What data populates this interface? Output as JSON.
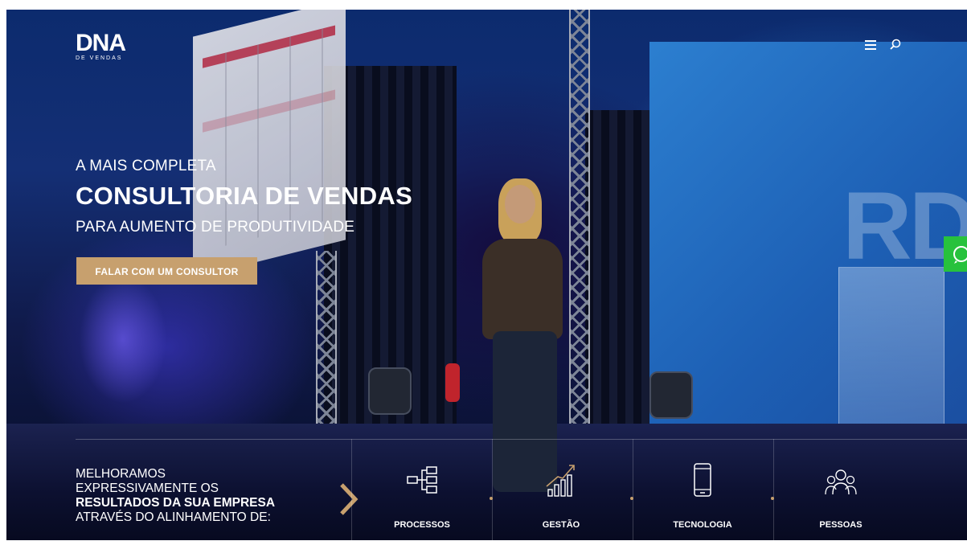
{
  "colors": {
    "accent": "#c7a06e",
    "whatsapp": "#27c23d",
    "text": "#ffffff"
  },
  "header": {
    "logo_main": "DNA",
    "logo_sub": "DE VENDAS",
    "menu_icon": "hamburger-menu-icon",
    "search_icon": "search-icon"
  },
  "hero": {
    "kicker": "A MAIS COMPLETA",
    "headline": "CONSULTORIA DE VENDAS",
    "subhead": "PARA AUMENTO DE PRODUTIVIDADE",
    "cta_label": "FALAR COM UM CONSULTOR"
  },
  "whatsapp_icon": "whatsapp-icon",
  "band": {
    "line1": "MELHORAMOS",
    "line2": "EXPRESSIVAMENTE OS",
    "line3": "RESULTADOS DA SUA EMPRESA",
    "line4": "ATRAVÉS DO ALINHAMENTO DE:",
    "arrow_icon": "chevron-right-icon",
    "pillars": [
      {
        "label": "PROCESSOS",
        "icon": "process-flow-icon"
      },
      {
        "label": "GESTÃO",
        "icon": "growth-chart-icon"
      },
      {
        "label": "TECNOLOGIA",
        "icon": "smartphone-icon"
      },
      {
        "label": "PESSOAS",
        "icon": "people-group-icon"
      }
    ]
  }
}
